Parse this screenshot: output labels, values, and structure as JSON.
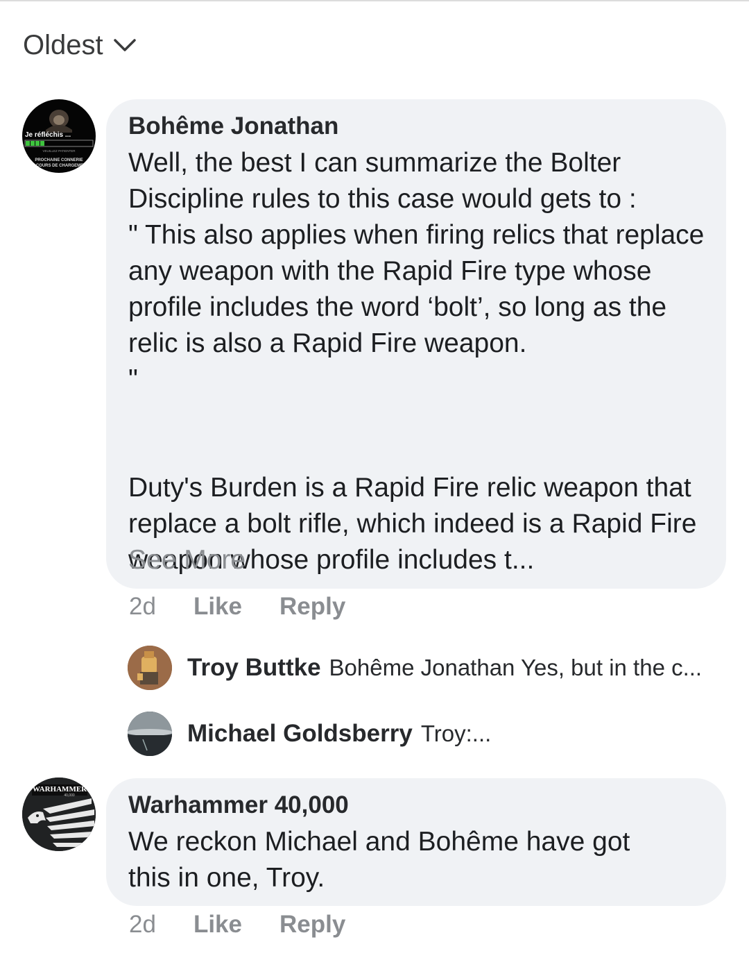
{
  "sort": {
    "label": "Oldest"
  },
  "comments": [
    {
      "author": "Bohême Jonathan",
      "avatar_text": {
        "line1": "Je réfléchis ...",
        "line2": "VEUILLEZ PATIENTER",
        "line3": "PROCHAINE CONNERIE",
        "line4": "EN COURS DE CHARGEMENT"
      },
      "paragraphs": [
        "Well, the best I can summarize the Bolter Discipline rules to this case would gets to :\n\" This also applies when firing relics that replace any weapon with the Rapid Fire type whose profile includes the word ‘bolt’, so long as the relic is also a Rapid Fire weapon.\n\"",
        "Duty's Burden is a Rapid Fire relic weapon that replace a bolt rifle, which indeed is a Rapid Fire weapon whose profile includes t..."
      ],
      "see_more": "See More",
      "time": "2d",
      "like": "Like",
      "reply": "Reply"
    },
    {
      "author": "Warhammer 40,000",
      "avatar_text": {
        "line1": "WARHAMMER",
        "line2": "40,000"
      },
      "text": "We reckon Michael and Bohême have got this in one, Troy.",
      "time": "2d",
      "like": "Like",
      "reply": "Reply"
    }
  ],
  "replies": [
    {
      "name": "Troy Buttke",
      "snippet": "Bohême Jonathan Yes, but in the c..."
    },
    {
      "name": "Michael Goldsberry",
      "snippet": "Troy:..."
    }
  ],
  "colors": {
    "bubble": "#f0f2f5",
    "meta": "#8a8d91",
    "text": "#1c1e21"
  }
}
